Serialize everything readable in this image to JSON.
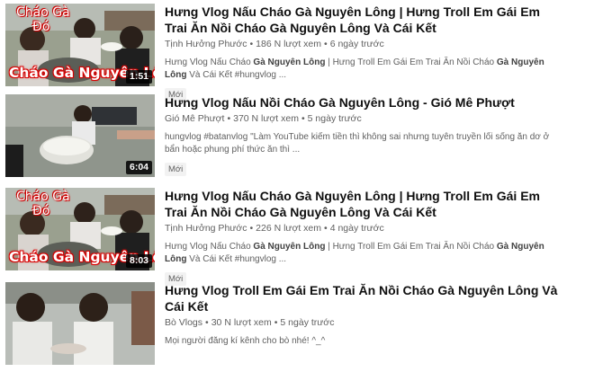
{
  "results": [
    {
      "title": "Hưng Vlog Nấu Cháo Gà Nguyên Lông | Hưng Troll Em Gái Em Trai Ăn Nồi Cháo Gà Nguyên Lông Và Cái Kết",
      "channel": "Tịnh Hưởng Phước",
      "views": "186 N lượt xem",
      "age": "6 ngày trước",
      "desc_parts": [
        {
          "t": "Hưng Vlog Nấu Cháo ",
          "b": false
        },
        {
          "t": "Gà Nguyên Lông",
          "b": true
        },
        {
          "t": " | Hưng Troll Em Gái Em Trai Ăn Nồi Cháo ",
          "b": false
        },
        {
          "t": "Gà Nguyên Lông",
          "b": true
        },
        {
          "t": " Và Cái Kết #hungvlog ...",
          "b": false
        }
      ],
      "badge": "Mới",
      "duration": "1:51",
      "overlay_top": [
        "Cháo Gà",
        "Đó"
      ],
      "overlay_bottom": "Cháo Gà Nguyên Lông"
    },
    {
      "title": "Hưng Vlog Nấu Nồi Cháo Gà Nguyên Lông - Gió Mê Phượt",
      "channel": "Gió Mê Phượt",
      "views": "370 N lượt xem",
      "age": "5 ngày trước",
      "desc_parts": [
        {
          "t": "hungvlog #batanvlog \"Làm YouTube kiếm tiền thì không sai nhưng tuyên truyền lối sống ăn dơ ở bẩn hoặc phung phí thức ăn thì ...",
          "b": false
        }
      ],
      "badge": "Mới",
      "duration": "6:04",
      "overlay_top": [],
      "overlay_bottom": ""
    },
    {
      "title": "Hưng Vlog Nấu Cháo Gà Nguyên Lông | Hưng Troll Em Gái Em Trai Ăn Nồi Cháo Gà Nguyên Lông Và Cái Kết",
      "channel": "Tịnh Hưởng Phước",
      "views": "226 N lượt xem",
      "age": "4 ngày trước",
      "desc_parts": [
        {
          "t": "Hưng Vlog Nấu Cháo ",
          "b": false
        },
        {
          "t": "Gà Nguyên Lông",
          "b": true
        },
        {
          "t": " | Hưng Troll Em Gái Em Trai Ăn Nồi Cháo ",
          "b": false
        },
        {
          "t": "Gà Nguyên Lông",
          "b": true
        },
        {
          "t": " Và Cái Kết #hungvlog ...",
          "b": false
        }
      ],
      "badge": "Mới",
      "duration": "8:03",
      "overlay_top": [
        "Cháo Gà",
        "Đó"
      ],
      "overlay_bottom": "Cháo Gà Nguyên Lông"
    },
    {
      "title": "Hưng Vlog Troll Em Gái Em Trai Ăn Nồi Cháo Gà Nguyên Lông Và Cái Kết",
      "channel": "Bò Vlogs",
      "views": "30 N lượt xem",
      "age": "5 ngày trước",
      "desc_parts": [
        {
          "t": "Mọi người đăng kí kênh cho bò nhé! ^_^",
          "b": false
        }
      ],
      "badge": "",
      "duration": "",
      "overlay_top": [],
      "overlay_bottom": ""
    }
  ],
  "colors": {
    "title": "#0f0f0f",
    "meta": "#606060",
    "badge_bg": "#f2f2f2",
    "overlay_outline": "#cc0000"
  }
}
